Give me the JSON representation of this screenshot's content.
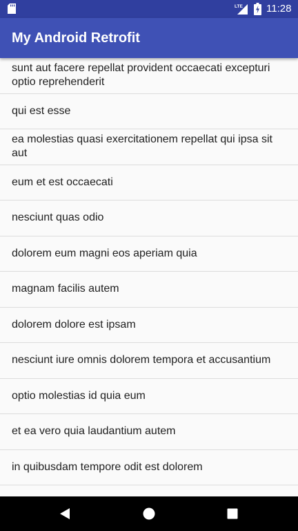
{
  "status_bar": {
    "time": "11:28",
    "network_label": "LTE",
    "icons": [
      "sd-card-icon",
      "lte-signal-icon",
      "battery-charging-icon"
    ]
  },
  "app_bar": {
    "title": "My Android Retrofit"
  },
  "list": {
    "items": [
      "sunt aut facere repellat provident occaecati excepturi optio reprehenderit",
      "qui est esse",
      "ea molestias quasi exercitationem repellat qui ipsa sit aut",
      "eum et est occaecati",
      "nesciunt quas odio",
      "dolorem eum magni eos aperiam quia",
      "magnam facilis autem",
      "dolorem dolore est ipsam",
      "nesciunt iure omnis dolorem tempora et accusantium",
      "optio molestias id quia eum",
      "et ea vero quia laudantium autem",
      "in quibusdam tempore odit est dolorem"
    ]
  },
  "nav_bar": {
    "icons": [
      "back-icon",
      "home-icon",
      "recents-icon"
    ]
  },
  "colors": {
    "status_bar": "#303f9f",
    "app_bar": "#3f51b5",
    "background": "#fafafa",
    "divider": "#dcdcdc",
    "text_primary": "#212121",
    "nav_bar": "#000000"
  }
}
